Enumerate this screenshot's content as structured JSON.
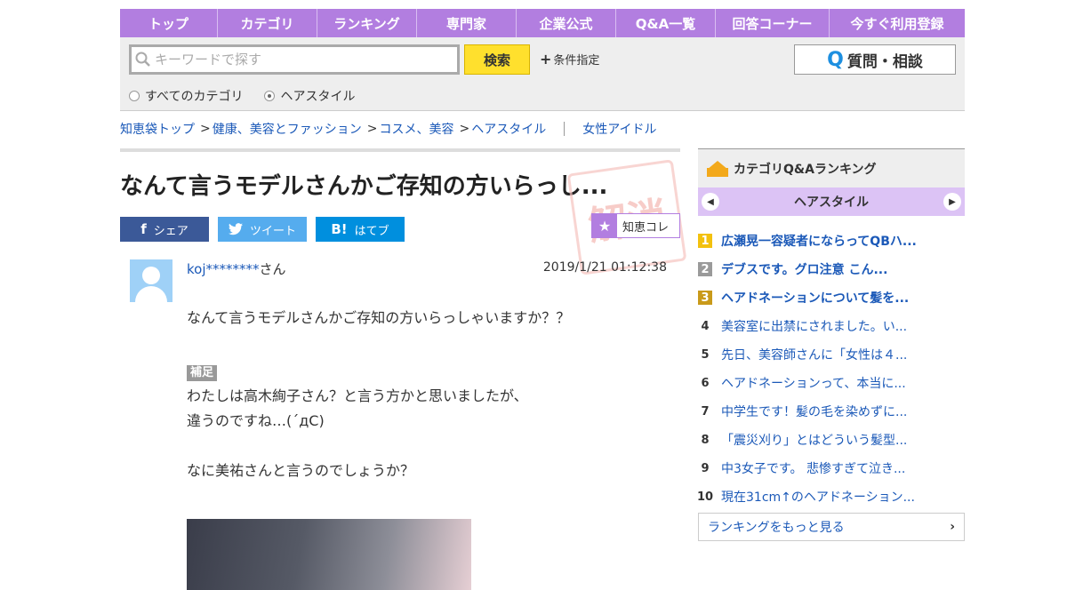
{
  "nav": [
    "トップ",
    "カテゴリ",
    "ランキング",
    "専門家",
    "企業公式",
    "Q&A一覧",
    "回答コーナー",
    "今すぐ利用登録"
  ],
  "search": {
    "placeholder": "キーワードで探す",
    "button": "検索",
    "conditions": "条件指定",
    "ask_button": "質問・相談",
    "radio_all": "すべてのカテゴリ",
    "radio_current": "ヘアスタイル"
  },
  "breadcrumb": {
    "items": [
      "知恵袋トップ",
      "健康、美容とファッション",
      "コスメ、美容",
      "ヘアスタイル"
    ],
    "tag": "女性アイドル"
  },
  "question": {
    "title": "なんて言うモデルさんかご存知の方いらっし...",
    "stamp": "解消",
    "share_fb": "シェア",
    "share_tw": "ツイート",
    "share_hb": "はてブ",
    "chiekore": "知恵コレ",
    "user": "koj********",
    "user_suffix": "さん",
    "date": "2019/1/21  01:12:38",
    "body1": "なんて言うモデルさんかご存知の方いらっしゃいますか？？",
    "supplement_label": "補足",
    "body2": "わたしは高木絢子さん？と言う方かと思いましたが、",
    "body3": "違うのですね…(´дC)",
    "body4": "なに美祐さんと言うのでしょうか？"
  },
  "ranking": {
    "header": "カテゴリQ&Aランキング",
    "tab": "ヘアスタイル",
    "items": [
      "広瀬晃一容疑者にならってQBハ...",
      "デブスです。グロ注意 こん...",
      "ヘアドネーションについて髪を...",
      "美容室に出禁にされました。い...",
      "先日、美容師さんに「女性は４...",
      "ヘアドネーションって、本当に...",
      "中学生です！髪の毛を染めずに...",
      "「震災刈り」とはどういう髪型...",
      "中3女子です。 悲惨すぎて泣き...",
      "現在31cm↑のヘアドネーション..."
    ],
    "more": "ランキングをもっと見る"
  }
}
